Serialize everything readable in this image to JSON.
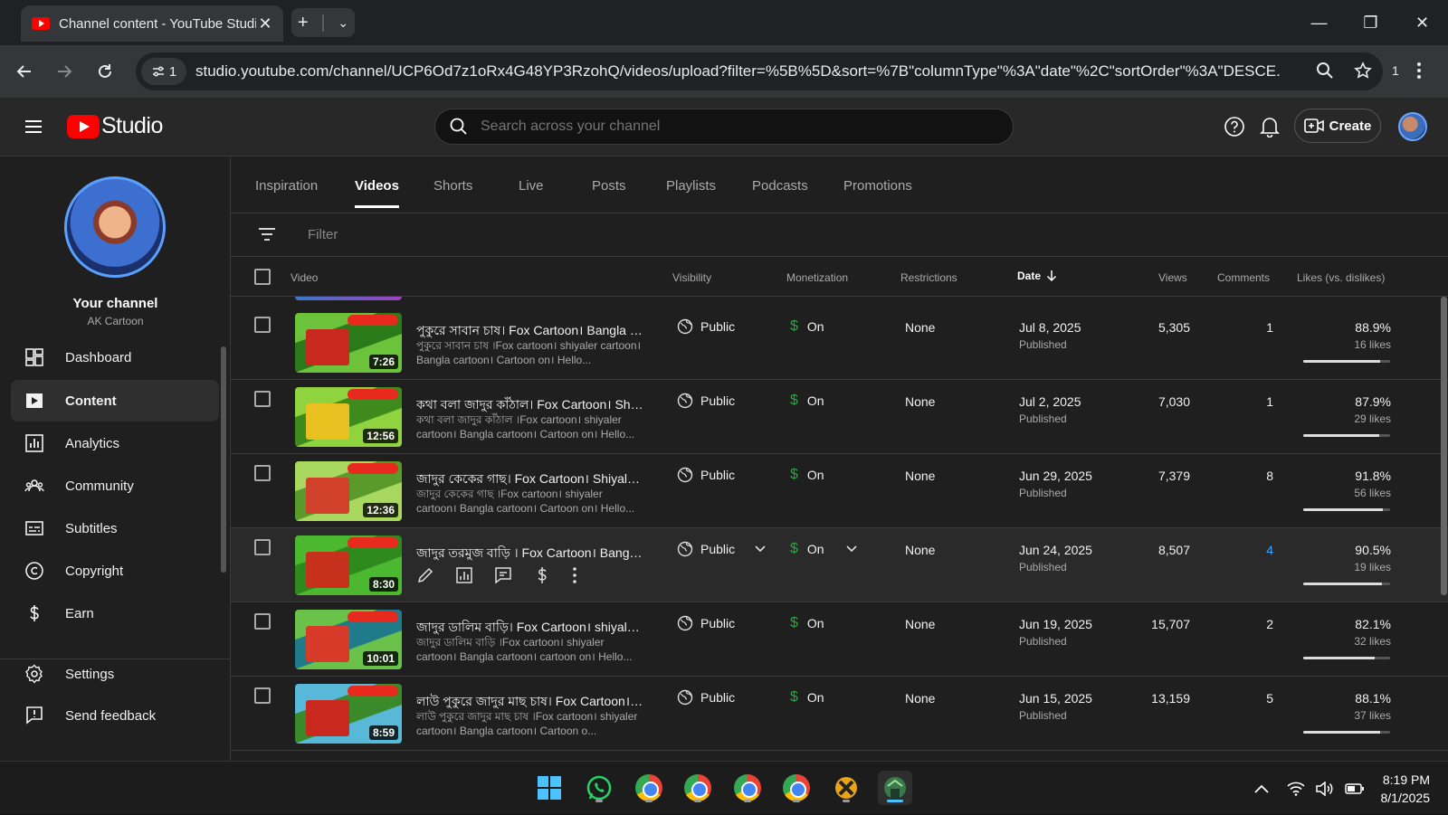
{
  "browser": {
    "tab_title": "Channel content - YouTube Studio",
    "url": "studio.youtube.com/channel/UCP6Od7z1oRx4G48YP3RzohQ/videos/upload?filter=%5B%5D&sort=%7B\"columnType\"%3A\"date\"%2C\"sortOrder\"%3A\"DESCE...",
    "site_chip_count": "1",
    "extensions_count": "1"
  },
  "header": {
    "logo_text": "Studio",
    "search_placeholder": "Search across your channel",
    "create_label": "Create"
  },
  "sidebar": {
    "channel_title": "Your channel",
    "channel_name": "AK Cartoon",
    "items": [
      {
        "label": "Dashboard",
        "icon": "dashboard-icon"
      },
      {
        "label": "Content",
        "icon": "content-icon",
        "active": true
      },
      {
        "label": "Analytics",
        "icon": "analytics-icon"
      },
      {
        "label": "Community",
        "icon": "community-icon"
      },
      {
        "label": "Subtitles",
        "icon": "subtitles-icon"
      },
      {
        "label": "Copyright",
        "icon": "copyright-icon"
      },
      {
        "label": "Earn",
        "icon": "earn-icon"
      }
    ],
    "bottom": [
      {
        "label": "Settings",
        "icon": "settings-icon"
      },
      {
        "label": "Send feedback",
        "icon": "feedback-icon"
      }
    ]
  },
  "content_tabs": [
    "Inspiration",
    "Videos",
    "Shorts",
    "Live",
    "Posts",
    "Playlists",
    "Podcasts",
    "Promotions"
  ],
  "active_tab": "Videos",
  "filter_placeholder": "Filter",
  "columns": {
    "video": "Video",
    "visibility": "Visibility",
    "monetization": "Monetization",
    "restrictions": "Restrictions",
    "date": "Date",
    "views": "Views",
    "comments": "Comments",
    "likes": "Likes (vs. dislikes)"
  },
  "videos": [
    {
      "title": "পুকুরে সাবান চাষ। Fox Cartoon। Bangla Car...",
      "description": "পুকুরে সাবান চাষ ।Fox cartoon। shiyaler cartoon। Bangla cartoon। Cartoon on। Hello...",
      "duration": "7:26",
      "visibility": "Public",
      "monetization": "On",
      "restrictions": "None",
      "date": "Jul 8, 2025",
      "status": "Published",
      "views": "5,305",
      "comments": "1",
      "likes_pct": "88.9%",
      "likes_count": "16 likes",
      "likes_ratio": 0.889,
      "thumb_colors": [
        "#2a7a1a",
        "#c8281e",
        "#6cc23a"
      ]
    },
    {
      "title": "কথা বলা জাদুর কাঁঠাল। Fox Cartoon। Shiyal...",
      "description": "কথা বলা জাদুর কাঁঠাল ।Fox cartoon। shiyaler cartoon। Bangla cartoon। Cartoon on। Hello...",
      "duration": "12:56",
      "visibility": "Public",
      "monetization": "On",
      "restrictions": "None",
      "date": "Jul 2, 2025",
      "status": "Published",
      "views": "7,030",
      "comments": "1",
      "likes_pct": "87.9%",
      "likes_count": "29 likes",
      "likes_ratio": 0.879,
      "thumb_colors": [
        "#3f8a1c",
        "#e8c020",
        "#8fd43e"
      ]
    },
    {
      "title": "জাদুর কেকের গাছ। Fox Cartoon। Shiyaler ...",
      "description": "জাদুর কেকের গাছ ।Fox cartoon। shiyaler cartoon। Bangla cartoon। Cartoon on। Hello...",
      "duration": "12:36",
      "visibility": "Public",
      "monetization": "On",
      "restrictions": "None",
      "date": "Jun 29, 2025",
      "status": "Published",
      "views": "7,379",
      "comments": "8",
      "likes_pct": "91.8%",
      "likes_count": "56 likes",
      "likes_ratio": 0.918,
      "thumb_colors": [
        "#5a9a2a",
        "#d0402a",
        "#a8d860"
      ]
    },
    {
      "title": "জাদুর তরমুজ বাড়ি । Fox Cartoon। Bangla C...",
      "description": "",
      "duration": "8:30",
      "visibility": "Public",
      "monetization": "On",
      "restrictions": "None",
      "date": "Jun 24, 2025",
      "status": "Published",
      "views": "8,507",
      "comments": "4",
      "comments_link": true,
      "likes_pct": "90.5%",
      "likes_count": "19 likes",
      "likes_ratio": 0.905,
      "hover": true,
      "thumb_colors": [
        "#2f8a1e",
        "#c8301e",
        "#4cb830"
      ]
    },
    {
      "title": "জাদুর ডালিম বাড়ি। Fox Cartoon। shiyaler C...",
      "description": "জাদুর ডালিম বাড়ি ।Fox cartoon। shiyaler cartoon। Bangla cartoon। cartoon on। Hello...",
      "duration": "10:01",
      "visibility": "Public",
      "monetization": "On",
      "restrictions": "None",
      "date": "Jun 19, 2025",
      "status": "Published",
      "views": "15,707",
      "comments": "2",
      "likes_pct": "82.1%",
      "likes_count": "32 likes",
      "likes_ratio": 0.821,
      "thumb_colors": [
        "#1f7a8a",
        "#d83a2a",
        "#6ac24a"
      ]
    },
    {
      "title": "লাউ পুকুরে জাদুর মাছ চাষ। Fox Cartoon। sh...",
      "description": "লাউ পুকুরে জাদুর মাছ চাষ ।Fox cartoon। shiyaler cartoon। Bangla cartoon। Cartoon o...",
      "duration": "8:59",
      "visibility": "Public",
      "monetization": "On",
      "restrictions": "None",
      "date": "Jun 15, 2025",
      "status": "Published",
      "views": "13,159",
      "comments": "5",
      "likes_pct": "88.1%",
      "likes_count": "37 likes",
      "likes_ratio": 0.881,
      "thumb_colors": [
        "#3a8a2a",
        "#c8281e",
        "#58b8d8"
      ]
    }
  ],
  "taskbar": {
    "time": "8:19 PM",
    "date": "8/1/2025"
  }
}
